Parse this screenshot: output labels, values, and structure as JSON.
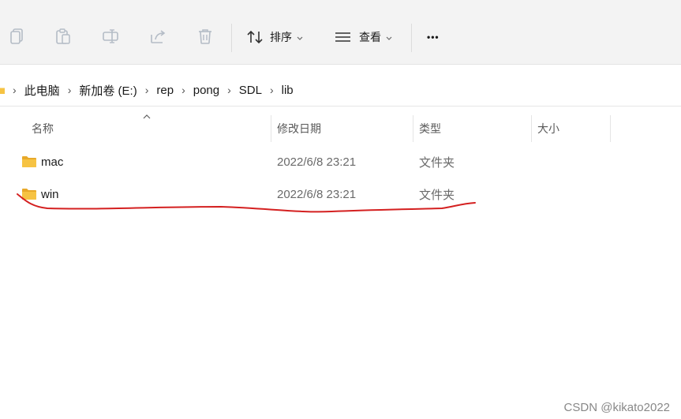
{
  "toolbar": {
    "icons": [
      {
        "name": "copy-icon"
      },
      {
        "name": "paste-icon"
      },
      {
        "name": "rename-icon"
      },
      {
        "name": "share-icon"
      },
      {
        "name": "delete-icon"
      }
    ],
    "sort_label": "排序",
    "view_label": "查看",
    "more_label": "•••"
  },
  "breadcrumb": [
    "此电脑",
    "新加卷 (E:)",
    "rep",
    "pong",
    "SDL",
    "lib"
  ],
  "columns": {
    "name": "名称",
    "date": "修改日期",
    "type": "类型",
    "size": "大小"
  },
  "files": [
    {
      "name": "mac",
      "date": "2022/6/8 23:21",
      "type": "文件夹",
      "size": ""
    },
    {
      "name": "win",
      "date": "2022/6/8 23:21",
      "type": "文件夹",
      "size": ""
    }
  ],
  "watermark": "CSDN @kikato2022",
  "colors": {
    "folder": "#f6c343",
    "annotation": "#d42020"
  }
}
